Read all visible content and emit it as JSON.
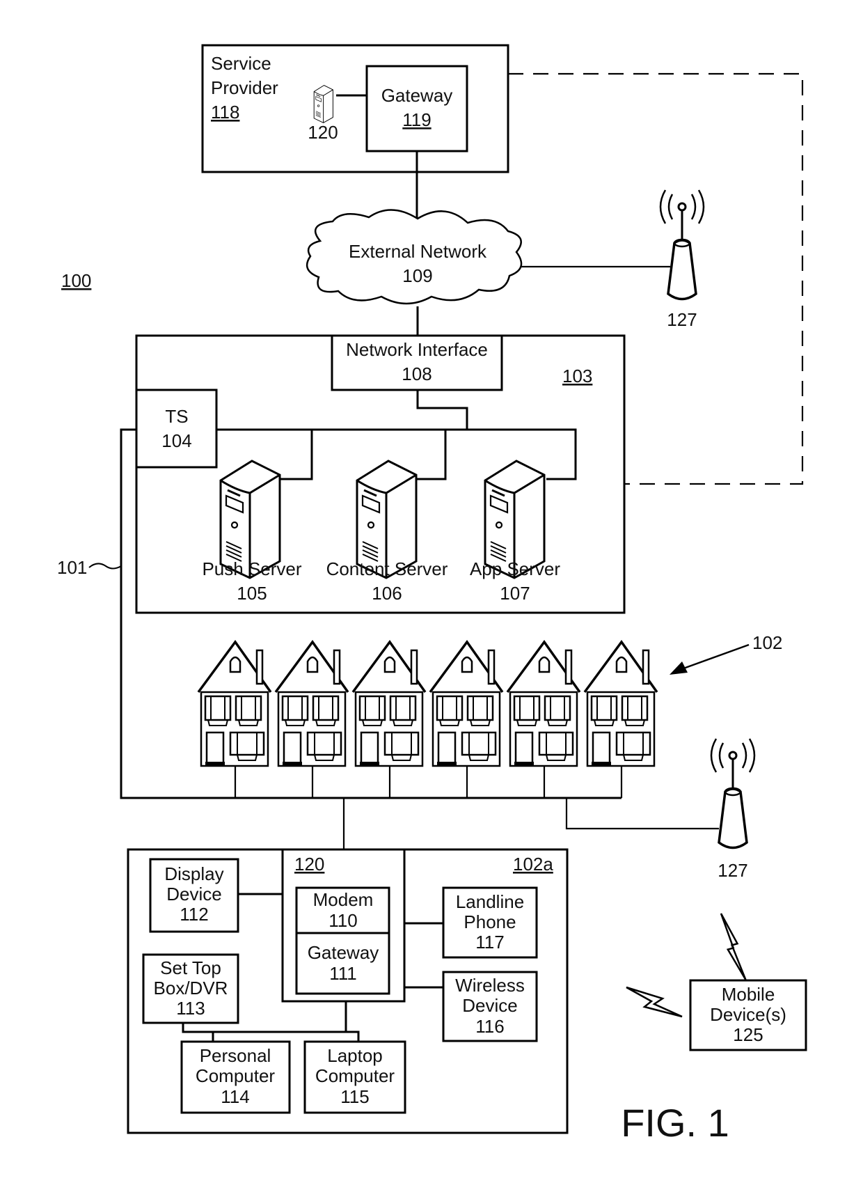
{
  "figure": {
    "title": "FIG. 1",
    "system_ref": "100",
    "link_ref": "101",
    "premises_ref": "102"
  },
  "service_provider": {
    "label_line1": "Service",
    "label_line2": "Provider",
    "ref": "118",
    "server_ref": "120",
    "gateway": {
      "label": "Gateway",
      "ref": "119"
    }
  },
  "external_network": {
    "label": "External Network",
    "ref": "109"
  },
  "towers": [
    {
      "ref": "127"
    },
    {
      "ref": "127"
    }
  ],
  "local_office": {
    "ref": "103",
    "network_interface": {
      "label": "Network Interface",
      "ref": "108"
    },
    "ts": {
      "label": "TS",
      "ref": "104"
    },
    "servers": [
      {
        "label": "Push Server",
        "ref": "105"
      },
      {
        "label": "Content Server",
        "ref": "106"
      },
      {
        "label": "App Server",
        "ref": "107"
      }
    ]
  },
  "houses_count": 6,
  "premises": {
    "ref": "102a",
    "interface_ref": "120",
    "modem": {
      "label": "Modem",
      "ref": "110"
    },
    "gateway": {
      "label": "Gateway",
      "ref": "111"
    },
    "devices": {
      "display": {
        "line1": "Display",
        "line2": "Device",
        "ref": "112"
      },
      "stb": {
        "line1": "Set Top",
        "line2": "Box/DVR",
        "ref": "113"
      },
      "pc": {
        "line1": "Personal",
        "line2": "Computer",
        "ref": "114"
      },
      "laptop": {
        "line1": "Laptop",
        "line2": "Computer",
        "ref": "115"
      },
      "wireless": {
        "line1": "Wireless",
        "line2": "Device",
        "ref": "116"
      },
      "landline": {
        "line1": "Landline",
        "line2": "Phone",
        "ref": "117"
      }
    }
  },
  "mobile": {
    "line1": "Mobile",
    "line2": "Device(s)",
    "ref": "125"
  }
}
